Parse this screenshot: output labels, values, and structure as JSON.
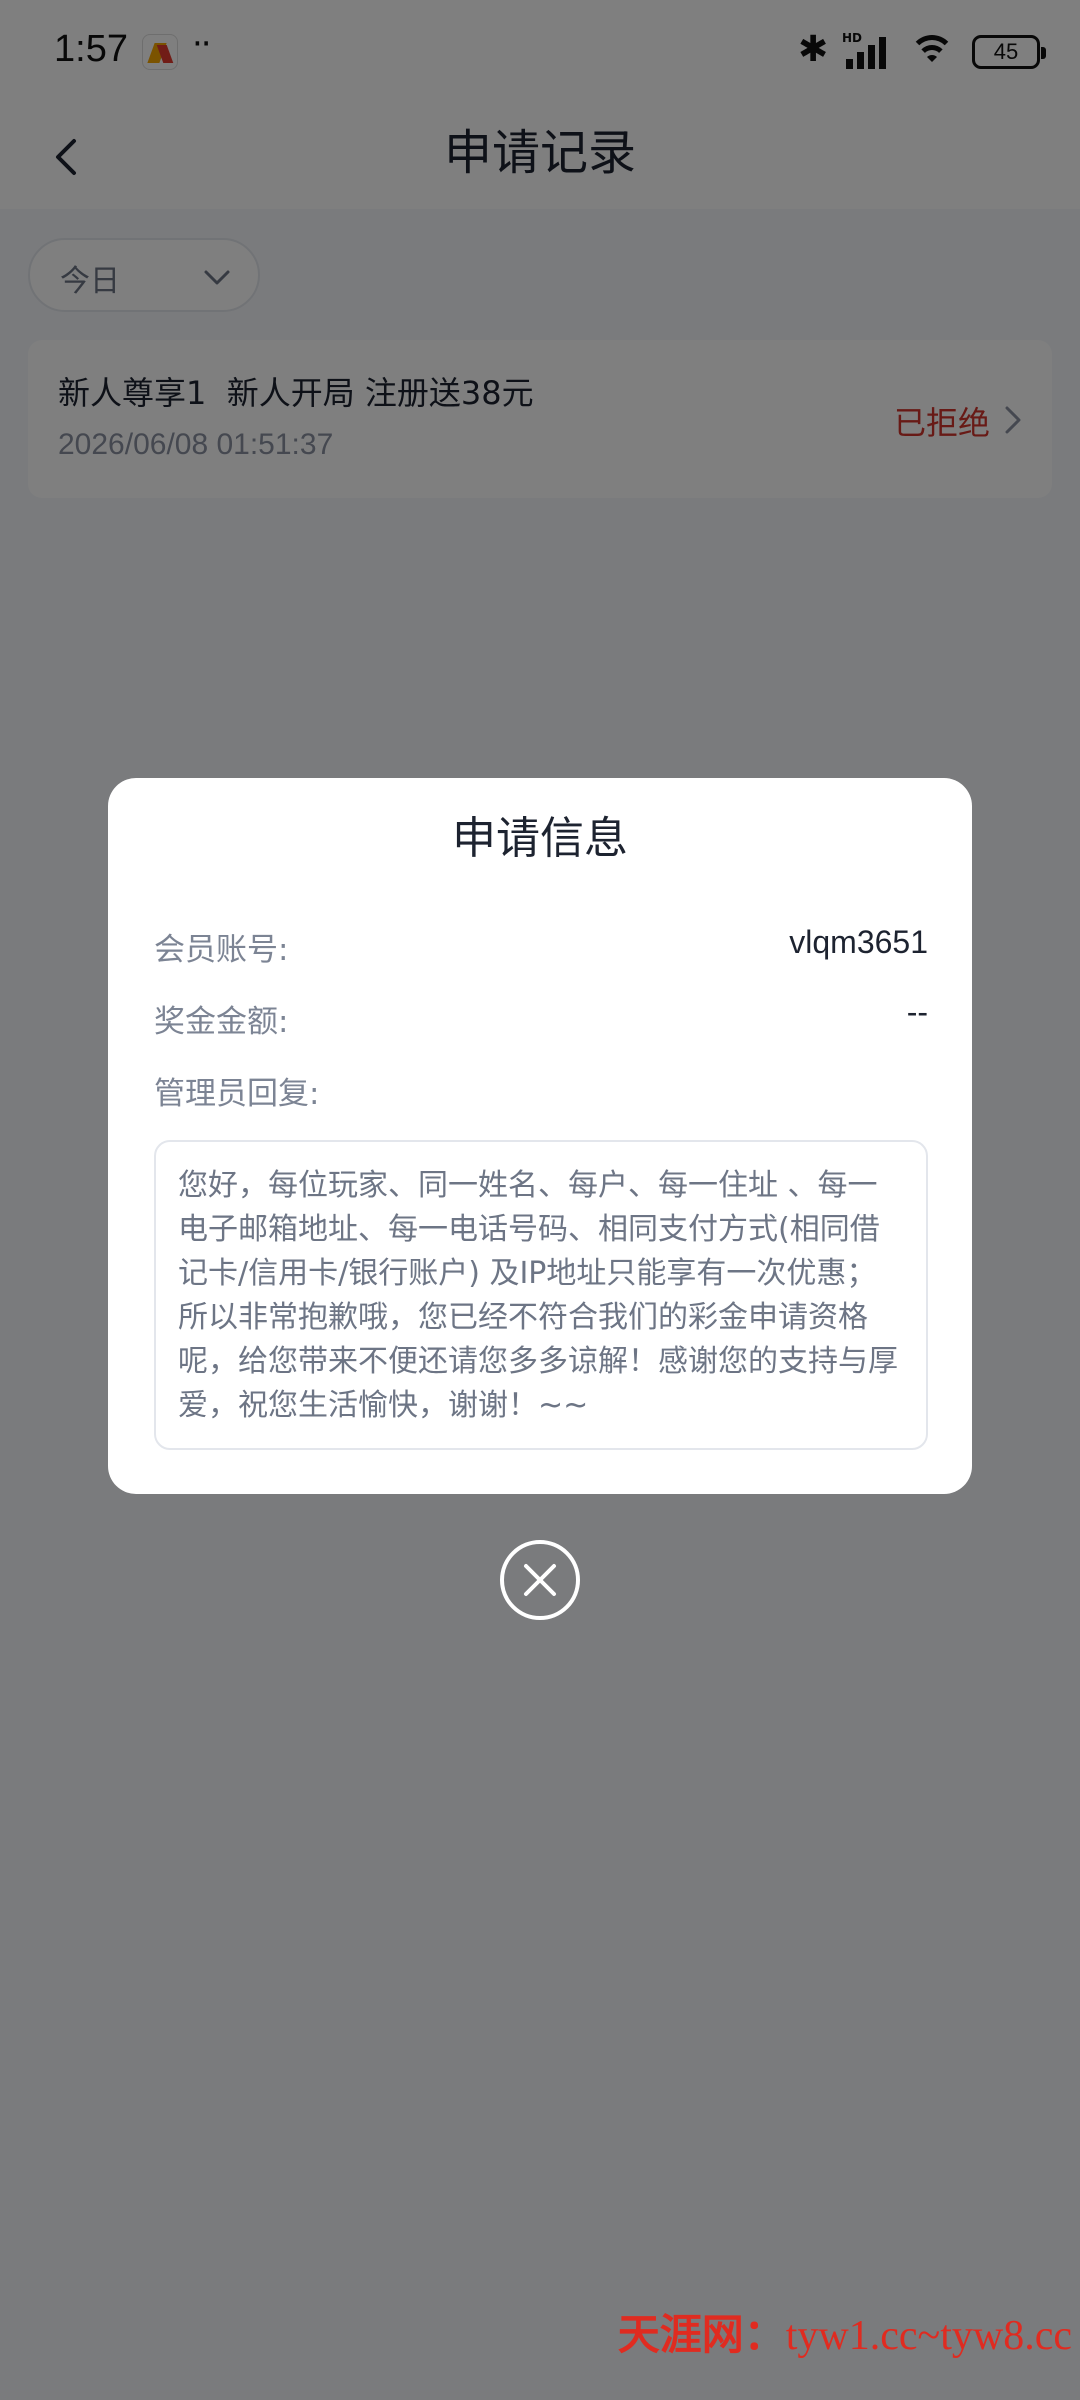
{
  "status_bar": {
    "time": "1:57",
    "dots": "··",
    "network_label": "HD",
    "battery": "45",
    "icons": [
      "app-notification-icon",
      "bluetooth-icon",
      "signal-icon",
      "wifi-icon",
      "battery-icon"
    ]
  },
  "header": {
    "title": "申请记录",
    "back_icon": "chevron-left-icon"
  },
  "filter": {
    "selected": "今日",
    "icon": "chevron-down-icon"
  },
  "records": [
    {
      "title": "新人尊享1  新人开局 注册送38元",
      "time": "2026/06/08 01:51:37",
      "status": "已拒绝",
      "status_color": "#d0342c"
    }
  ],
  "modal": {
    "title": "申请信息",
    "fields": {
      "member_label": "会员账号:",
      "member_value": "vlqm3651",
      "bonus_label": "奖金金额:",
      "bonus_value": "--",
      "reply_label": "管理员回复:"
    },
    "reply_text": "您好，每位玩家、同一姓名、每户、每一住址 、每一电子邮箱地址、每一电话号码、相同支付方式(相同借记卡/信用卡/银行账户) 及IP地址只能享有一次优惠；所以非常抱歉哦，您已经不符合我们的彩金申请资格呢，给您带来不便还请您多多谅解！感谢您的支持与厚爱，祝您生活愉快，谢谢！~~"
  },
  "close_icon": "close-circle-icon",
  "watermark": {
    "brand": "天涯网：",
    "urls": "tyw1.cc~tyw8.cc"
  }
}
